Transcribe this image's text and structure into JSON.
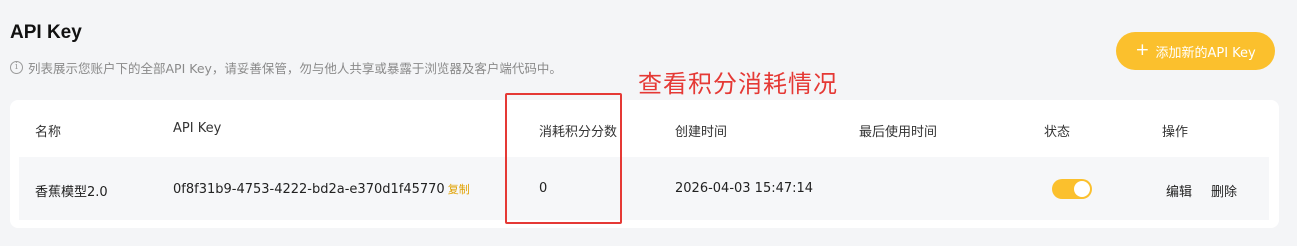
{
  "page": {
    "title": "API Key",
    "info_icon_glyph": "i",
    "description": "列表展示您账户下的全部API Key，请妥善保管，勿与他人共享或暴露于浏览器及客户端代码中。"
  },
  "add_button": {
    "icon": "plus-icon",
    "plus_glyph": "+",
    "label": "添加新的API Key"
  },
  "annotation": {
    "text": "查看积分消耗情况",
    "color": "#e53935"
  },
  "table": {
    "columns": {
      "name": "名称",
      "api_key": "API Key",
      "credits_used": "消耗积分分数",
      "created_at": "创建时间",
      "last_used": "最后使用时间",
      "status": "状态",
      "actions": "操作"
    },
    "rows": [
      {
        "name": "香蕉模型2.0",
        "api_key": "0f8f31b9-4753-4222-bd2a-e370d1f45770",
        "copy_label": "复制",
        "credits_used": "0",
        "created_at": "2026-04-03 15:47:14",
        "last_used": "",
        "status_enabled": true,
        "edit_label": "编辑",
        "delete_label": "删除"
      }
    ]
  },
  "colors": {
    "accent": "#fbc02d",
    "annotation": "#e53935",
    "copy_link": "#e0a100"
  }
}
